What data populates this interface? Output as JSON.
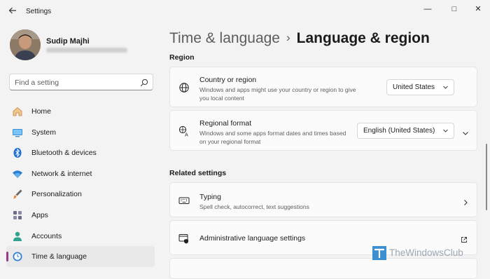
{
  "window": {
    "title": "Settings",
    "controls": [
      "—",
      "□",
      "✕"
    ]
  },
  "profile": {
    "name": "Sudip Majhi"
  },
  "search": {
    "placeholder": "Find a setting"
  },
  "sidebar": {
    "items": [
      {
        "label": "Home",
        "icon": "home-icon"
      },
      {
        "label": "System",
        "icon": "system-icon"
      },
      {
        "label": "Bluetooth & devices",
        "icon": "bluetooth-icon"
      },
      {
        "label": "Network & internet",
        "icon": "wifi-icon"
      },
      {
        "label": "Personalization",
        "icon": "brush-icon"
      },
      {
        "label": "Apps",
        "icon": "apps-icon"
      },
      {
        "label": "Accounts",
        "icon": "accounts-icon"
      },
      {
        "label": "Time & language",
        "icon": "time-language-icon",
        "active": true
      }
    ]
  },
  "header": {
    "parent": "Time & language",
    "separator": "›",
    "current": "Language & region"
  },
  "region": {
    "heading": "Region",
    "country": {
      "title": "Country or region",
      "description": "Windows and apps might use your country or region to give you local content",
      "value": "United States"
    },
    "format": {
      "title": "Regional format",
      "description": "Windows and some apps format dates and times based on your regional format",
      "value": "English (United States)"
    }
  },
  "related": {
    "heading": "Related settings",
    "typing": {
      "title": "Typing",
      "description": "Spell check, autocorrect, text suggestions"
    },
    "admin": {
      "title": "Administrative language settings"
    }
  },
  "watermark": {
    "text": "TheWindowsClub"
  },
  "colors": {
    "accent": "#9c3a86",
    "background": "#f3f3f3",
    "card": "#fbfbfb"
  }
}
